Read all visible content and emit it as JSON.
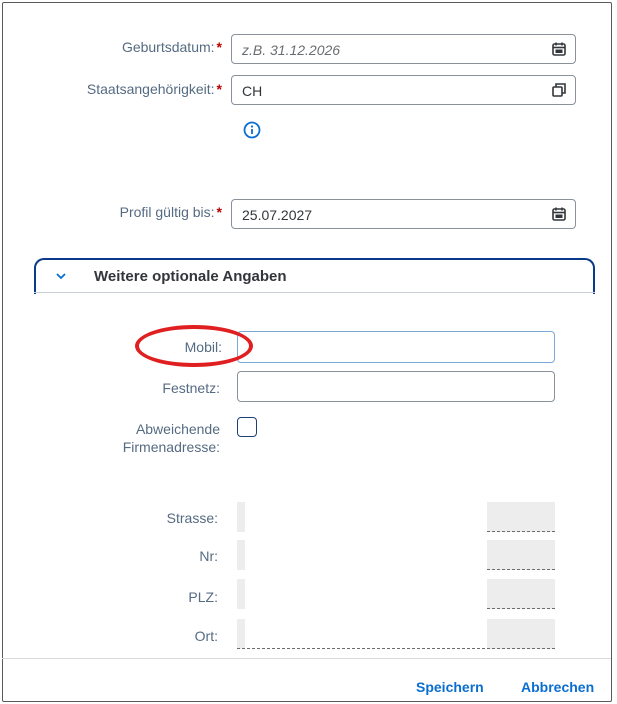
{
  "form": {
    "birthdate": {
      "label": "Geburtsdatum:",
      "required_mark": "*",
      "placeholder": "z.B. 31.12.2026",
      "icon": "calendar-icon"
    },
    "nationality": {
      "label": "Staatsangehörigkeit:",
      "required_mark": "*",
      "value": "CH",
      "icon": "value-help-icon",
      "info_icon": "info-icon"
    },
    "profile_valid": {
      "label": "Profil gültig bis:",
      "required_mark": "*",
      "value": "25.07.2027",
      "icon": "calendar-icon"
    }
  },
  "optional_panel": {
    "title": "Weitere optionale Angaben",
    "expanded": true,
    "mobile": {
      "label": "Mobil:",
      "value": ""
    },
    "landline": {
      "label": "Festnetz:",
      "value": ""
    },
    "different_address": {
      "label_line1": "Abweichende",
      "label_line2": "Firmenadresse:",
      "checked": false
    },
    "street": {
      "label": "Strasse:"
    },
    "number": {
      "label": "Nr:"
    },
    "zip": {
      "label": "PLZ:"
    },
    "city": {
      "label": "Ort:"
    }
  },
  "footer": {
    "save": "Speichern",
    "cancel": "Abbrechen"
  },
  "colors": {
    "accent": "#0a6ed1",
    "required": "#bb0000",
    "annotation": "#e02020",
    "panel_border": "#0a3a8a"
  }
}
